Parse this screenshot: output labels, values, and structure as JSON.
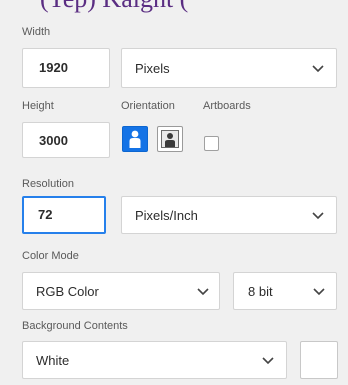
{
  "header_fragment": "(Tep) Kaight (",
  "width": {
    "label": "Width",
    "value": "1920",
    "unit": "Pixels"
  },
  "height": {
    "label": "Height",
    "value": "3000"
  },
  "orientation": {
    "label": "Orientation",
    "selected": "portrait"
  },
  "artboards": {
    "label": "Artboards",
    "checked": false
  },
  "resolution": {
    "label": "Resolution",
    "value": "72",
    "unit": "Pixels/Inch"
  },
  "color_mode": {
    "label": "Color Mode",
    "value": "RGB Color",
    "bit_depth": "8 bit"
  },
  "background": {
    "label": "Background Contents",
    "value": "White",
    "swatch_color": "#ffffff"
  },
  "colors": {
    "accent": "#1473e6",
    "focus": "#2680eb",
    "panel_bg": "#f0f0f0"
  }
}
